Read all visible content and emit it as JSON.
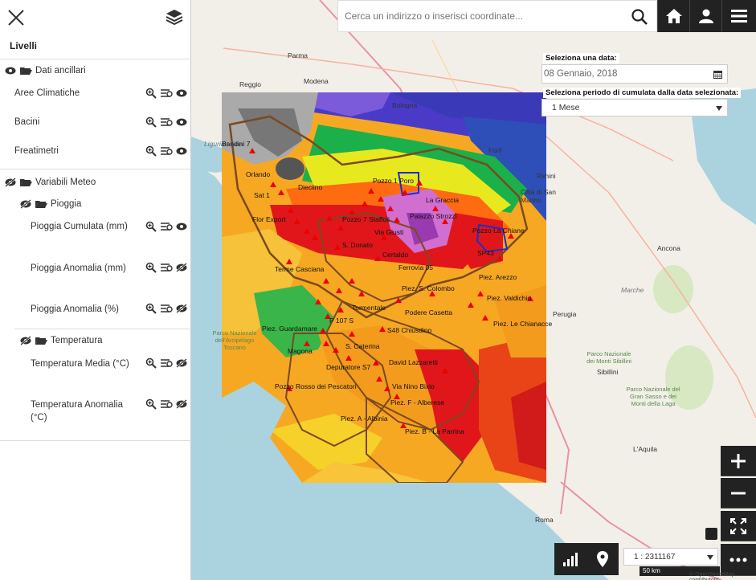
{
  "sidebar": {
    "title": "Livelli",
    "groups": {
      "ancillari": {
        "label": "Dati ancillari",
        "items": [
          {
            "label": "Aree Climatiche"
          },
          {
            "label": "Bacini"
          },
          {
            "label": "Freatimetri"
          }
        ]
      },
      "meteo": {
        "label": "Variabili Meteo",
        "pioggia": {
          "label": "Pioggia",
          "items": [
            {
              "label": "Pioggia Cumulata (mm)"
            },
            {
              "label": "Pioggia Anomalia (mm)"
            },
            {
              "label": "Pioggia Anomalia (%)"
            }
          ]
        },
        "temperatura": {
          "label": "Temperatura",
          "items": [
            {
              "label": "Temperatura Media (°C)"
            },
            {
              "label": "Temperatura Anomalia (°C)"
            }
          ]
        }
      }
    }
  },
  "search": {
    "placeholder": "Cerca un indirizzo o inserisci coordinate..."
  },
  "date_panel": {
    "date_label": "Seleziona una data:",
    "date_value": "08 Gennaio, 2018",
    "period_label": "Seleziona periodo di cumulata dalla data selezionata:",
    "period_value": "1 Mese"
  },
  "scale": {
    "value": "1 : 2311167",
    "bar_label": "50 km"
  },
  "attribution": "© OpenStreetMap contributors",
  "map_labels": [
    "Bologna",
    "Modena",
    "Parma",
    "Reggio",
    "Forlì",
    "Rimini",
    "Città di San Marino",
    "Ancona",
    "Perugia",
    "Roma",
    "L'Aquila",
    "Sibillini",
    "Marche",
    "Parco Nazionale dei Monti Sibillini",
    "Parco Nazionale del Gran Sasso e dei Monti della Laga",
    "Parco Nazionale dell'Arcipelago Toscano",
    "Ligurian Sea"
  ],
  "station_labels": [
    "Bandini 7",
    "Orlando",
    "Sat 1",
    "Dieciino",
    "Pozzo 1 Poro",
    "La Graccia",
    "Flor Export",
    "Pozzo 7 Staffoli",
    "Palazzo Strozzi",
    "Via Giusti",
    "Pozzo La Chiane",
    "S. Donato",
    "SP43",
    "Certaldo",
    "Terme Casciana",
    "Ferrovia 05",
    "Piez. Arezzo",
    "Piez. S. Colombo",
    "Tormentale",
    "Podere Casetta",
    "Piez. Valdichio",
    "Piez. Guardamare",
    "P 107 S",
    "Piez. Le Chianacce",
    "S48 Chiusdino",
    "Magona",
    "S. Caterina",
    "Depuratore S7",
    "David Lazzaretti",
    "Pozzo Rosso dei Pescatori",
    "Via Nino Bixio",
    "Piez. F - Alberese",
    "Piez. A - Albinia",
    "Piez. B - La Parrina"
  ],
  "colors": {
    "accent": "#222222",
    "station": "#e00000"
  }
}
